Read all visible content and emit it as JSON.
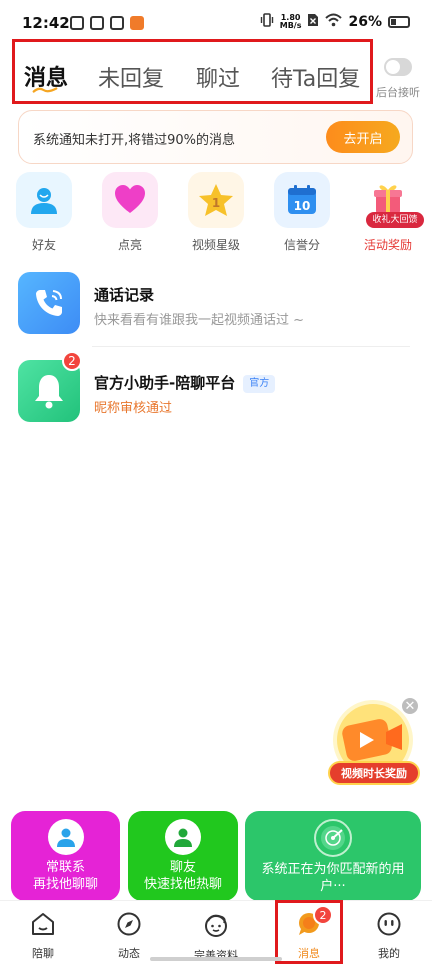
{
  "status_bar": {
    "time": "12:42",
    "network_speed_value": "1.80",
    "network_speed_unit": "MB/s",
    "battery": "26%"
  },
  "tabs": [
    {
      "label": "消息",
      "active": true
    },
    {
      "label": "未回复",
      "active": false
    },
    {
      "label": "聊过",
      "active": false
    },
    {
      "label": "待Ta回复",
      "active": false
    }
  ],
  "background_answer": {
    "label": "后台接听",
    "enabled": false
  },
  "notice_banner": {
    "text": "系统通知未打开,将错过90%的消息",
    "button": "去开启"
  },
  "shortcuts": [
    {
      "label": "好友",
      "icon": "person-icon",
      "tile_color": "#e8f6ff"
    },
    {
      "label": "点亮",
      "icon": "heart-icon",
      "tile_color": "#fde8f6"
    },
    {
      "label": "视频星级",
      "icon": "star-icon",
      "tile_color": "#fff6e6",
      "value": "1"
    },
    {
      "label": "信誉分",
      "icon": "calendar-icon",
      "tile_color": "#e8f3ff",
      "value": "10"
    },
    {
      "label": "活动奖励",
      "icon": "gift-icon",
      "tag": "收礼大回馈"
    }
  ],
  "conversations": [
    {
      "title": "通话记录",
      "subtitle": "快来看看有谁跟我一起视频通话过 ~",
      "icon": "phone-icon"
    },
    {
      "title": "官方小助手-陪聊平台",
      "tag": "官方",
      "subtitle": "昵称审核通过",
      "icon": "bell-icon",
      "badge": "2"
    }
  ],
  "floating_reward": {
    "label": "视频时长奖励",
    "icon": "video-camera-icon"
  },
  "action_cards": [
    {
      "line1": "常联系",
      "line2": "再找他聊聊",
      "color": "#e523d6"
    },
    {
      "line1": "聊友",
      "line2": "快速找他热聊",
      "color": "#21c81e"
    },
    {
      "line1": "系统正在为你匹配新的用",
      "line2": "户···",
      "color": "#2cc66a"
    }
  ],
  "bottom_nav": [
    {
      "label": "陪聊",
      "icon": "home-icon",
      "active": false
    },
    {
      "label": "动态",
      "icon": "compass-icon",
      "active": false
    },
    {
      "label": "完善资料",
      "icon": "profile-face-icon",
      "active": false
    },
    {
      "label": "消息",
      "icon": "message-bubble-icon",
      "active": true,
      "badge": "2"
    },
    {
      "label": "我的",
      "icon": "smiley-icon",
      "active": false
    }
  ]
}
